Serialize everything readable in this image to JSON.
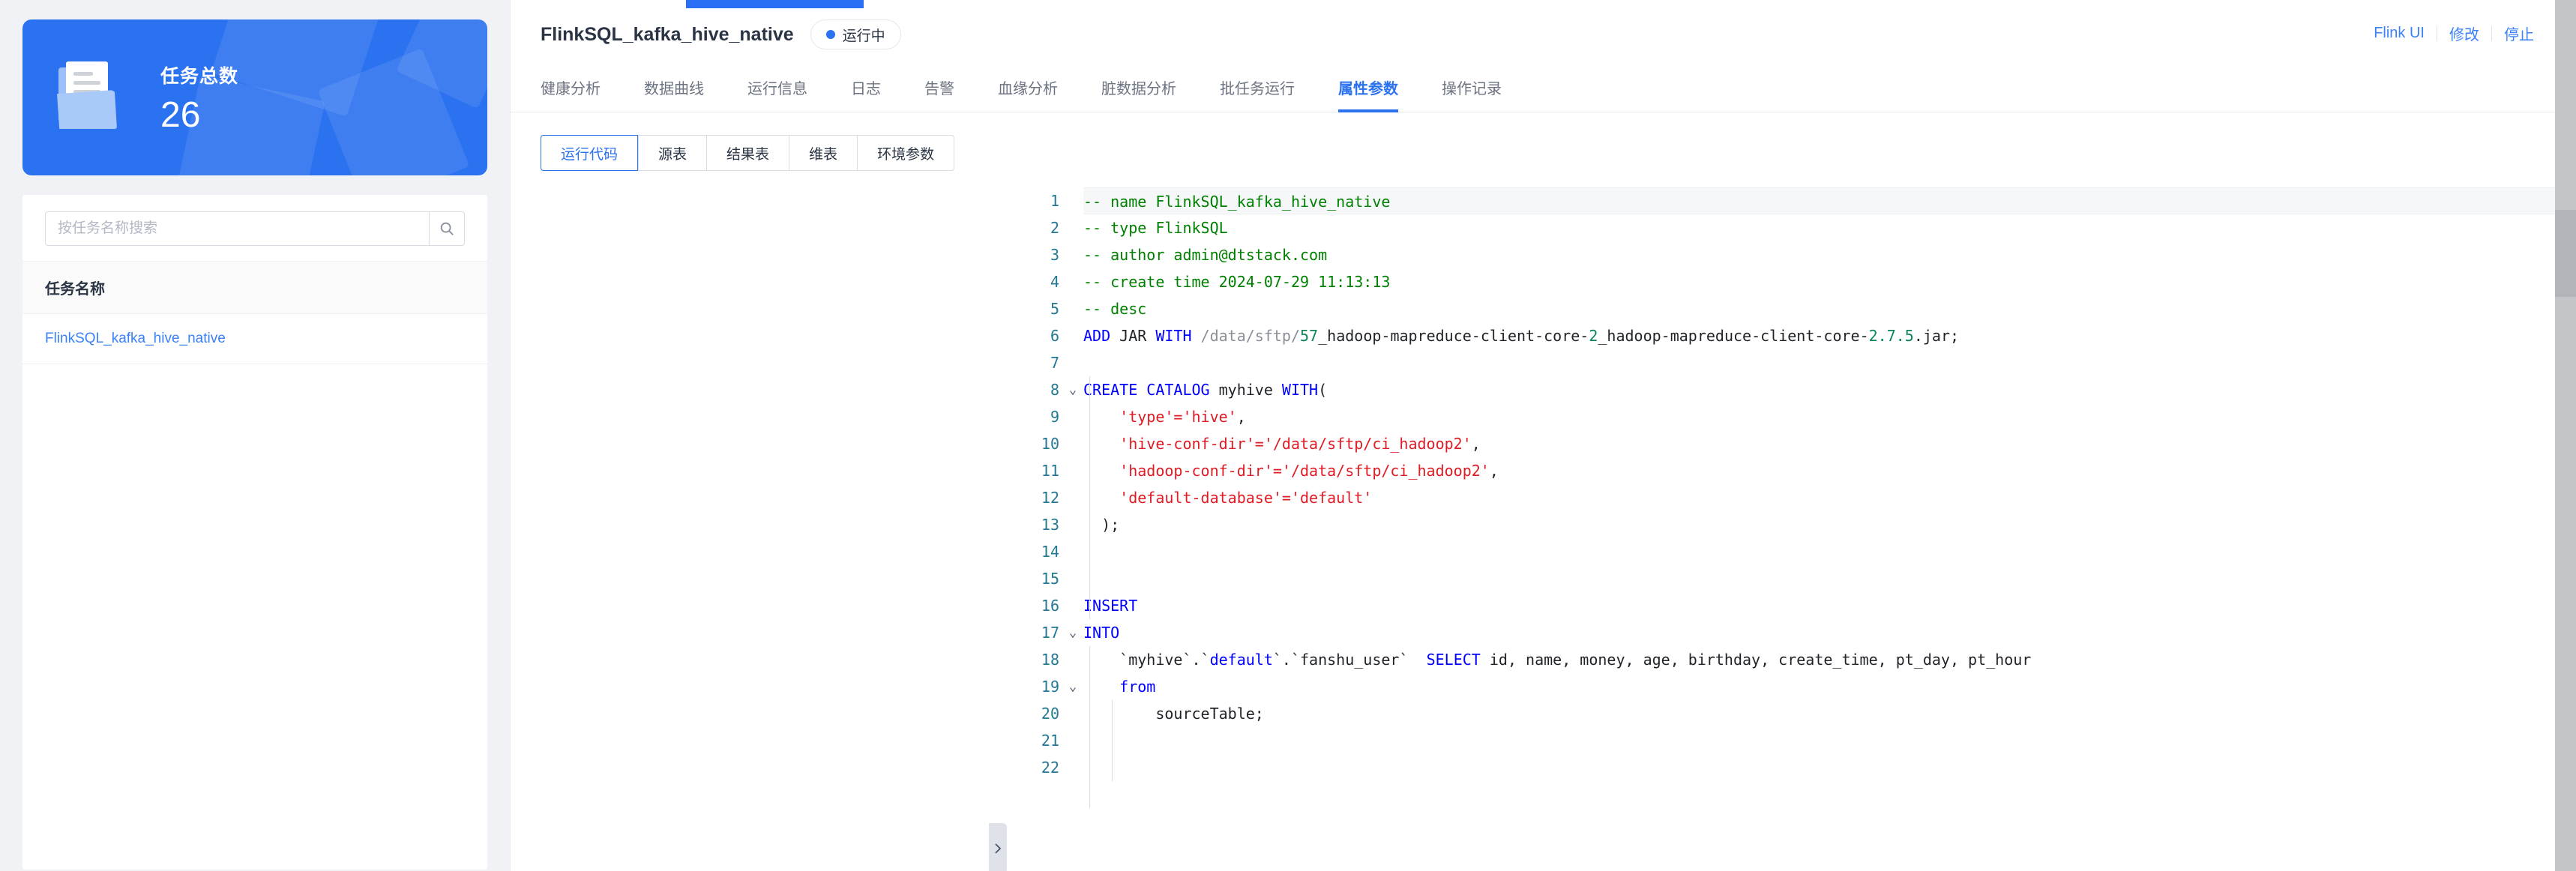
{
  "left_panel": {
    "stat_card": {
      "title": "任务总数",
      "value": "26"
    },
    "search": {
      "placeholder": "按任务名称搜索",
      "value": "",
      "icon": "search-icon"
    },
    "table": {
      "header": "任务名称",
      "rows": [
        {
          "name": "FlinkSQL_kafka_hive_native"
        }
      ]
    }
  },
  "detail": {
    "title": "FlinkSQL_kafka_hive_native",
    "status": {
      "label": "运行中",
      "dot_color": "#2b72f0"
    },
    "actions": [
      {
        "label": "Flink UI"
      },
      {
        "label": "修改"
      },
      {
        "label": "停止"
      }
    ],
    "tabs": [
      {
        "label": "健康分析",
        "active": false
      },
      {
        "label": "数据曲线",
        "active": false
      },
      {
        "label": "运行信息",
        "active": false
      },
      {
        "label": "日志",
        "active": false
      },
      {
        "label": "告警",
        "active": false
      },
      {
        "label": "血缘分析",
        "active": false
      },
      {
        "label": "脏数据分析",
        "active": false
      },
      {
        "label": "批任务运行",
        "active": false
      },
      {
        "label": "属性参数",
        "active": true
      },
      {
        "label": "操作记录",
        "active": false
      }
    ],
    "sub_tabs": [
      {
        "label": "运行代码",
        "active": true
      },
      {
        "label": "源表",
        "active": false
      },
      {
        "label": "结果表",
        "active": false
      },
      {
        "label": "维表",
        "active": false
      },
      {
        "label": "环境参数",
        "active": false
      }
    ]
  },
  "editor": {
    "line_numbers": [
      "1",
      "2",
      "3",
      "4",
      "5",
      "6",
      "7",
      "8",
      "9",
      "10",
      "11",
      "12",
      "13",
      "14",
      "15",
      "16",
      "17",
      "18",
      "19",
      "20",
      "21",
      "22"
    ],
    "fold_markers": {
      "8": "v",
      "17": "v",
      "19": "v"
    },
    "lines": [
      "-- name FlinkSQL_kafka_hive_native",
      "-- type FlinkSQL",
      "-- author admin@dtstack.com",
      "-- create time 2024-07-29 11:13:13",
      "-- desc",
      "ADD JAR WITH /data/sftp/57_hadoop-mapreduce-client-core-2_hadoop-mapreduce-client-core-2.7.5.jar;",
      "",
      "CREATE CATALOG myhive WITH(",
      "    'type'='hive',",
      "    'hive-conf-dir'='/data/sftp/ci_hadoop2',",
      "    'hadoop-conf-dir'='/data/sftp/ci_hadoop2',",
      "    'default-database'='default'",
      "  );",
      "",
      "",
      "INSERT",
      "INTO",
      "    `myhive`.`default`.`fanshu_user`  SELECT id, name, money, age, birthday, create_time, pt_day, pt_hour",
      "    from",
      "        sourceTable;",
      "",
      ""
    ],
    "collapse_handle_icon": "chevron-right-icon"
  }
}
